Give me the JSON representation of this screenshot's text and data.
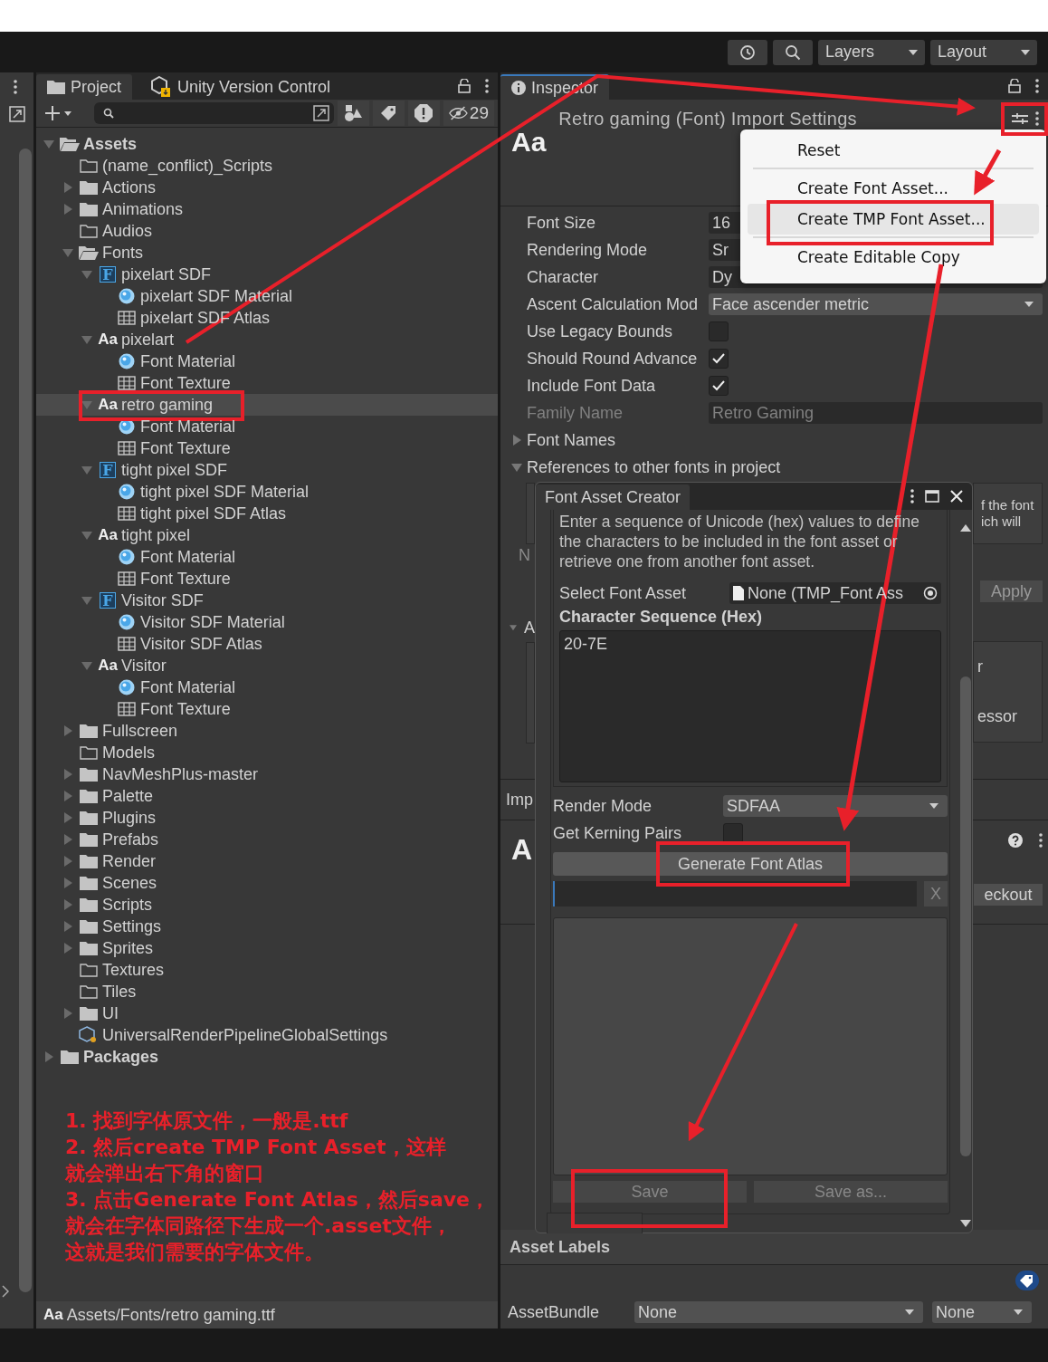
{
  "toolbar": {
    "buttons": [
      {
        "kind": "history"
      },
      {
        "kind": "search"
      }
    ],
    "dropdowns": [
      "Layers",
      "Layout"
    ]
  },
  "project": {
    "tabs": [
      {
        "label": "Project",
        "selected": true
      },
      {
        "label": "Unity Version Control",
        "selected": false
      }
    ],
    "hidden_count": "29",
    "tree": [
      {
        "label": "Assets",
        "kind": "folder",
        "selected": false,
        "expanded": true,
        "children": [
          {
            "label": "(name_conflict)_Scripts",
            "kind": "empty-folder",
            "selected": false
          },
          {
            "label": "Actions",
            "kind": "folder",
            "selected": false,
            "expanded": false
          },
          {
            "label": "Animations",
            "kind": "folder",
            "selected": false,
            "expanded": false
          },
          {
            "label": "Audios",
            "kind": "empty-folder",
            "selected": false
          },
          {
            "label": "Fonts",
            "kind": "folder",
            "selected": false,
            "expanded": true,
            "children": [
              {
                "label": "pixelart SDF",
                "kind": "font-asset",
                "badge": "F",
                "selected": false,
                "expanded": true,
                "children": [
                  {
                    "label": "pixelart SDF Material",
                    "kind": "material",
                    "selected": false
                  },
                  {
                    "label": "pixelart SDF Atlas",
                    "kind": "texture",
                    "selected": false
                  }
                ]
              },
              {
                "label": "pixelart",
                "kind": "font",
                "badge": "Aa",
                "selected": false,
                "expanded": true,
                "children": [
                  {
                    "label": "Font Material",
                    "kind": "material",
                    "selected": false
                  },
                  {
                    "label": "Font Texture",
                    "kind": "texture",
                    "selected": false
                  }
                ]
              },
              {
                "label": "retro gaming",
                "kind": "font",
                "badge": "Aa",
                "selected": true,
                "expanded": true,
                "children": [
                  {
                    "label": "Font Material",
                    "kind": "material",
                    "selected": false
                  },
                  {
                    "label": "Font Texture",
                    "kind": "texture",
                    "selected": false
                  }
                ]
              },
              {
                "label": "tight pixel SDF",
                "kind": "font-asset",
                "badge": "F",
                "selected": false,
                "expanded": true,
                "children": [
                  {
                    "label": "tight pixel SDF Material",
                    "kind": "material",
                    "selected": false
                  },
                  {
                    "label": "tight pixel SDF Atlas",
                    "kind": "texture",
                    "selected": false
                  }
                ]
              },
              {
                "label": "tight pixel",
                "kind": "font",
                "badge": "Aa",
                "selected": false,
                "expanded": true,
                "children": [
                  {
                    "label": "Font Material",
                    "kind": "material",
                    "selected": false
                  },
                  {
                    "label": "Font Texture",
                    "kind": "texture",
                    "selected": false
                  }
                ]
              },
              {
                "label": "Visitor SDF",
                "kind": "font-asset",
                "badge": "F",
                "selected": false,
                "expanded": true,
                "children": [
                  {
                    "label": "Visitor SDF Material",
                    "kind": "material",
                    "selected": false
                  },
                  {
                    "label": "Visitor SDF Atlas",
                    "kind": "texture",
                    "selected": false
                  }
                ]
              },
              {
                "label": "Visitor",
                "kind": "font",
                "badge": "Aa",
                "selected": false,
                "expanded": true,
                "children": [
                  {
                    "label": "Font Material",
                    "kind": "material",
                    "selected": false
                  },
                  {
                    "label": "Font Texture",
                    "kind": "texture",
                    "selected": false
                  }
                ]
              }
            ]
          },
          {
            "label": "Fullscreen",
            "kind": "folder",
            "selected": false,
            "expanded": false
          },
          {
            "label": "Models",
            "kind": "empty-folder",
            "selected": false
          },
          {
            "label": "NavMeshPlus-master",
            "kind": "folder",
            "selected": false,
            "expanded": false
          },
          {
            "label": "Palette",
            "kind": "folder",
            "selected": false,
            "expanded": false
          },
          {
            "label": "Plugins",
            "kind": "folder",
            "selected": false,
            "expanded": false
          },
          {
            "label": "Prefabs",
            "kind": "folder",
            "selected": false,
            "expanded": false
          },
          {
            "label": "Render",
            "kind": "folder",
            "selected": false,
            "expanded": false
          },
          {
            "label": "Scenes",
            "kind": "folder",
            "selected": false,
            "expanded": false
          },
          {
            "label": "Scripts",
            "kind": "folder",
            "selected": false,
            "expanded": false
          },
          {
            "label": "Settings",
            "kind": "folder",
            "selected": false,
            "expanded": false
          },
          {
            "label": "Sprites",
            "kind": "folder",
            "selected": false,
            "expanded": false
          },
          {
            "label": "Textures",
            "kind": "empty-folder",
            "selected": false
          },
          {
            "label": "Tiles",
            "kind": "empty-folder",
            "selected": false
          },
          {
            "label": "UI",
            "kind": "folder",
            "selected": false,
            "expanded": false
          },
          {
            "label": "UniversalRenderPipelineGlobalSettings",
            "kind": "settings",
            "selected": false
          }
        ]
      },
      {
        "label": "Packages",
        "kind": "folder",
        "selected": false,
        "expanded": false
      }
    ],
    "annotation": [
      "1. 找到字体原文件，一般是.ttf",
      "2. 然后create TMP Font Asset，这样",
      "就会弹出右下角的窗口",
      "3. 点击Generate Font Atlas，然后save，",
      "就会在字体同路径下生成一个.asset文件，",
      "这就是我们需要的字体文件。"
    ],
    "path": {
      "badge": "Aa",
      "text": "Assets/Fonts/retro gaming.ttf"
    }
  },
  "inspector": {
    "tab": "Inspector",
    "header": {
      "badge": "Aa",
      "title": "Retro gaming (Font) Import Settings"
    },
    "properties": [
      {
        "kind": "field",
        "label": "Font Size",
        "value": "16",
        "disabled": false
      },
      {
        "kind": "field",
        "label": "Rendering Mode",
        "value": "Sr",
        "disabled": false
      },
      {
        "kind": "field",
        "label": "Character",
        "value": "Dy",
        "disabled": false
      },
      {
        "kind": "dropdown",
        "label": "Ascent Calculation Mod",
        "value": "Face ascender metric",
        "disabled": false
      },
      {
        "kind": "checkbox",
        "label": "Use Legacy Bounds",
        "checked": false,
        "disabled": false
      },
      {
        "kind": "checkbox",
        "label": "Should Round Advance",
        "checked": true,
        "disabled": false
      },
      {
        "kind": "checkbox",
        "label": "Include Font Data",
        "checked": true,
        "disabled": false
      },
      {
        "kind": "field",
        "label": "Family Name",
        "value": "Retro Gaming",
        "disabled": true
      }
    ],
    "foldouts": [
      {
        "label": "Font Names",
        "expanded": false
      },
      {
        "label": "References to other fonts in project",
        "expanded": true
      }
    ],
    "covered_left": {
      "note": "N",
      "foldout": "A",
      "section": "Imp",
      "header": "A"
    },
    "covered_right": {
      "help_lines": [
        "f the font",
        "ich will"
      ],
      "apply": "Apply",
      "box_lines": [
        "r",
        "essor"
      ],
      "checkout": "eckout"
    },
    "asset_labels": "Asset Labels",
    "asset_bundle": {
      "label": "AssetBundle",
      "values": [
        "None",
        "None"
      ]
    }
  },
  "context_menu": [
    {
      "label": "Reset",
      "separator_before": false,
      "selected": false
    },
    {
      "label": "Create Font Asset...",
      "separator_before": true,
      "selected": false
    },
    {
      "label": "Create TMP Font Asset...",
      "separator_before": false,
      "selected": true
    },
    {
      "label": "Create Editable Copy",
      "separator_before": true,
      "selected": false
    }
  ],
  "font_asset_creator": {
    "title": "Font Asset Creator",
    "description": "Enter a sequence of Unicode (hex) values to define the characters to be included in the font asset or retrieve one from another font asset.",
    "select_label": "Select Font Asset",
    "select_value": "None (TMP_Font Ass",
    "sequence_label": "Character Sequence (Hex)",
    "sequence": "20-7E",
    "render_mode": {
      "label": "Render Mode",
      "value": "SDFAA"
    },
    "kerning": {
      "label": "Get Kerning Pairs",
      "checked": false
    },
    "generate": "Generate Font Atlas",
    "progress": {
      "level": 0,
      "cancel": "X"
    },
    "save_buttons": [
      {
        "label": "Save",
        "disabled": true
      },
      {
        "label": "Save as...",
        "disabled": true
      }
    ]
  }
}
